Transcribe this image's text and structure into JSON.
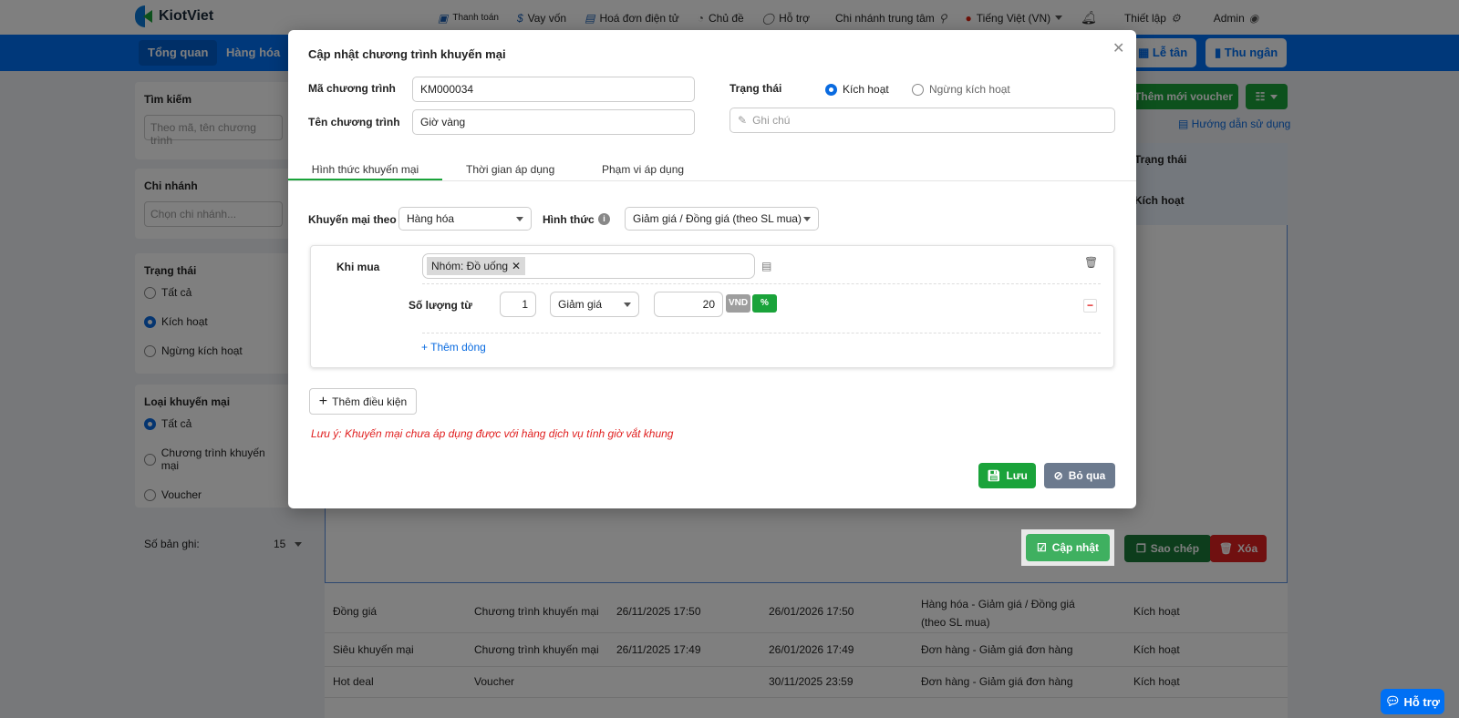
{
  "app": {
    "logo": "KiotViet"
  },
  "topbar": {
    "links": [
      "Thanh toán",
      "Vay vốn",
      "Hoá đơn điện tử",
      "Chủ đề",
      "Hỗ trợ"
    ],
    "branch": "Chi nhánh trung tâm",
    "language": "Tiếng Việt (VN)",
    "settings": "Thiết lập",
    "user": "Admin"
  },
  "nav": {
    "items": [
      "Tổng quan",
      "Hàng hóa"
    ],
    "le_tan": "Lễ tân",
    "thu_ngan": "Thu ngân"
  },
  "sidebar": {
    "search_title": "Tìm kiếm",
    "search_placeholder": "Theo mã, tên chương trình",
    "branch_title": "Chi nhánh",
    "branch_placeholder": "Chọn chi nhánh...",
    "status_title": "Trạng thái",
    "status_options": [
      "Tất cả",
      "Kích hoạt",
      "Ngừng kích hoạt"
    ],
    "type_title": "Loại khuyến mại",
    "type_options": [
      "Tất cả",
      "Chương trình khuyến mại",
      "Voucher"
    ],
    "records_label": "Số bản ghi:",
    "records_value": "15"
  },
  "toolbar": {
    "add_voucher": "Thêm mới voucher",
    "guide": "Hướng dẫn sử dụng"
  },
  "table": {
    "status_header": "Trạng thái",
    "selected_status": "Kích hoạt",
    "actions": {
      "update": "Cập nhật",
      "copy": "Sao chép",
      "delete": "Xóa"
    },
    "rows": [
      {
        "name": "Đồng giá",
        "type": "Chương trình khuyến mại",
        "from": "26/11/2025 17:50",
        "to": "26/01/2026 17:50",
        "form": "Hàng hóa - Giảm giá / Đồng giá (theo SL mua)",
        "status": "Kích hoạt"
      },
      {
        "name": "Siêu khuyến mại",
        "type": "Chương trình khuyến mại",
        "from": "26/11/2025 17:49",
        "to": "26/01/2026 17:49",
        "form": "Đơn hàng - Giảm giá đơn hàng",
        "status": "Kích hoạt"
      },
      {
        "name": "Hot deal",
        "type": "Voucher",
        "from": "",
        "to": "30/11/2025 23:59",
        "form": "Đơn hàng - Giảm giá đơn hàng",
        "status": "Kích hoạt"
      }
    ]
  },
  "modal": {
    "title": "Cập nhật chương trình khuyến mại",
    "code_label": "Mã chương trình",
    "code_value": "KM000034",
    "name_label": "Tên chương trình",
    "name_value": "Giờ vàng",
    "status_label": "Trạng thái",
    "status_active": "Kích hoạt",
    "status_inactive": "Ngừng kích hoạt",
    "note_placeholder": "Ghi chú",
    "tabs": [
      "Hình thức khuyến mại",
      "Thời gian áp dụng",
      "Phạm vi áp dụng"
    ],
    "promo_by_label": "Khuyến mại theo",
    "promo_by_value": "Hàng hóa",
    "form_label": "Hình thức",
    "form_value": "Giảm giá / Đồng giá (theo SL mua)",
    "when_buy_label": "Khi mua",
    "tag": "Nhóm: Đồ uống",
    "qty_label": "Số lượng từ",
    "qty_value": "1",
    "discount_type": "Giảm giá",
    "discount_value": "20",
    "unit_vnd": "VND",
    "unit_percent": "%",
    "add_row": "+ Thêm dòng",
    "add_condition": "Thêm điều kiện",
    "note": "Lưu ý: Khuyến mại chưa áp dụng được với hàng dịch vụ tính giờ vắt khung",
    "save": "Lưu",
    "skip": "Bỏ qua"
  },
  "help": "Hỗ trợ",
  "colors": {
    "brand": "#0070f4",
    "green": "#1aa33a",
    "red": "#e02020"
  }
}
